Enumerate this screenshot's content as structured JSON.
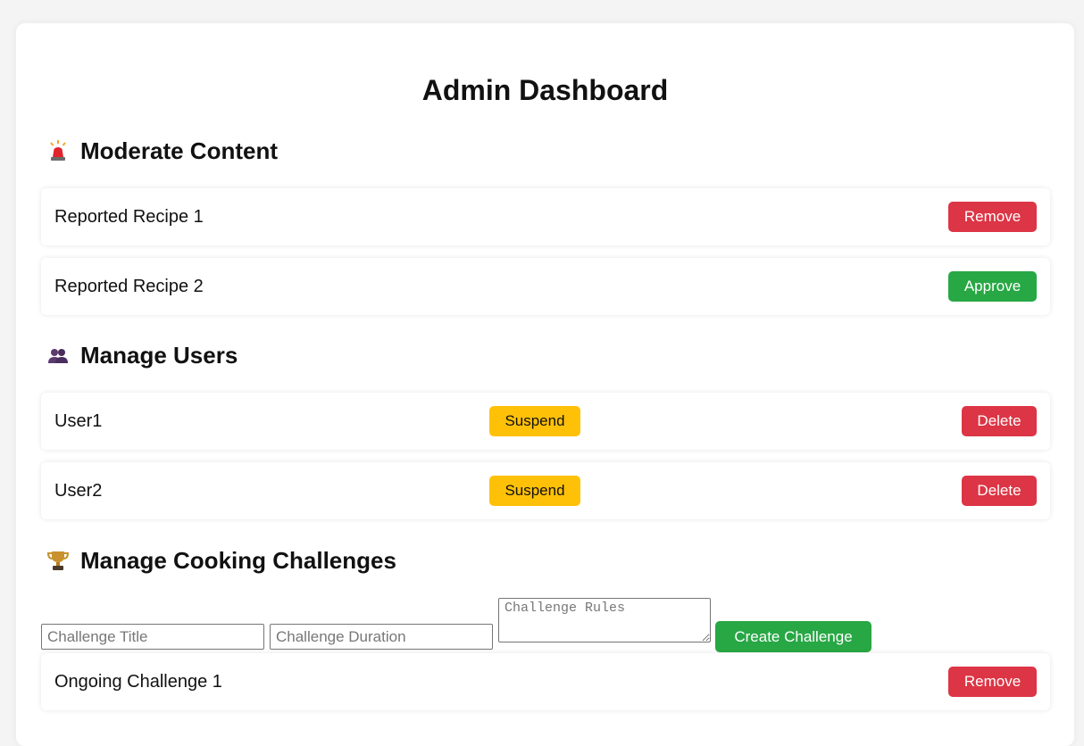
{
  "page": {
    "title": "Admin Dashboard"
  },
  "colors": {
    "danger": "#dc3545",
    "success": "#28a745",
    "warning": "#ffc107"
  },
  "sections": {
    "moderate": {
      "icon": "siren-icon",
      "heading": "Moderate Content",
      "items": [
        {
          "label": "Reported Recipe 1",
          "action": "Remove"
        },
        {
          "label": "Reported Recipe 2",
          "action": "Approve"
        }
      ]
    },
    "users": {
      "icon": "users-icon",
      "heading": "Manage Users",
      "items": [
        {
          "label": "User1",
          "suspend": "Suspend",
          "delete": "Delete"
        },
        {
          "label": "User2",
          "suspend": "Suspend",
          "delete": "Delete"
        }
      ]
    },
    "challenges": {
      "icon": "trophy-icon",
      "heading": "Manage Cooking Challenges",
      "form": {
        "title_placeholder": "Challenge Title",
        "title_value": "",
        "duration_placeholder": "Challenge Duration",
        "duration_value": "",
        "rules_placeholder": "Challenge Rules",
        "rules_value": "",
        "create_label": "Create Challenge"
      },
      "items": [
        {
          "label": "Ongoing Challenge 1",
          "action": "Remove"
        }
      ]
    }
  }
}
